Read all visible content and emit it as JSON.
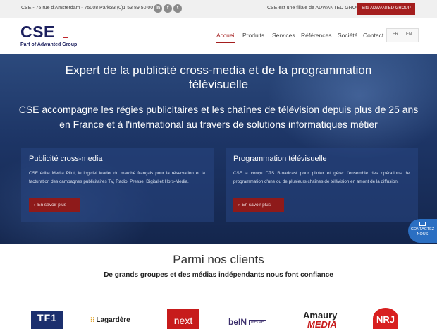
{
  "topbar": {
    "address": "CSE - 75 rue d'Amsterdam - 75008 Paris",
    "phone": "+33 (0)1 53 89 50 00",
    "social": [
      {
        "icon": "linkedin-icon",
        "glyph": "in"
      },
      {
        "icon": "facebook-icon",
        "glyph": "f"
      },
      {
        "icon": "twitter-icon",
        "glyph": "t"
      }
    ],
    "filiale_text": "CSE est une filiale de ADWANTED GROUP",
    "site_button": "Site ADWANTED GROUP"
  },
  "header": {
    "logo_text": "CSE",
    "logo_sub": "Part of Adwanted Group",
    "nav": [
      {
        "label": "Accueil",
        "active": true
      },
      {
        "label": "Produits",
        "active": false
      },
      {
        "label": "Services",
        "active": false
      },
      {
        "label": "Références",
        "active": false
      },
      {
        "label": "Société",
        "active": false
      },
      {
        "label": "Contact",
        "active": false
      }
    ],
    "languages": [
      {
        "icon": "flag-fr-icon",
        "label": "FR"
      },
      {
        "icon": "flag-uk-icon",
        "label": "EN"
      }
    ]
  },
  "hero": {
    "title": "Expert de la publicité cross-media et de la programmation télévisuelle",
    "subtitle": "CSE accompagne les régies publicitaires et les chaînes de télévision depuis plus de 25 ans en France et à l'international au travers de solutions informatiques métier",
    "cards": [
      {
        "title": "Publicité cross-media",
        "text": "CSE édite Media Pilot, le logiciel leader du marché français pour la réservation et la facturation des campagnes publicitaires TV, Radio, Presse, Digital et Hors-Media.",
        "button": "En savoir plus"
      },
      {
        "title": "Programmation télévisuelle",
        "text": "CSE a conçu CTS Broadcast pour piloter et gérer l'ensemble des opérations de programmation d'une ou de plusieurs chaînes de télévision en amont de la diffusion.",
        "button": "En savoir plus"
      }
    ],
    "contact_tab": {
      "line1": "CONTACTEZ",
      "line2": "NOUS",
      "icon": "envelope-icon"
    }
  },
  "clients": {
    "title": "Parmi nos clients",
    "subtitle": "De grands groupes et des médias indépendants nous font confiance",
    "logos": [
      {
        "name": "tf1-publicite-logo",
        "text": "TF1"
      },
      {
        "name": "lagardere-publicite-logo",
        "text": "Lagardère"
      },
      {
        "name": "next-logo",
        "text": "next"
      },
      {
        "name": "bein-regie-logo",
        "text": "beIN",
        "badge": "REGIE"
      },
      {
        "name": "amaury-media-logo",
        "text": "Amaury",
        "text2": "MEDIA"
      },
      {
        "name": "nrj-logo",
        "text": "NRJ"
      }
    ]
  },
  "colors": {
    "accent": "#a41e1e",
    "brand_navy": "#1b1f5e",
    "hero_blue": "#1d3566",
    "contact_blue": "#2b6fc2"
  }
}
